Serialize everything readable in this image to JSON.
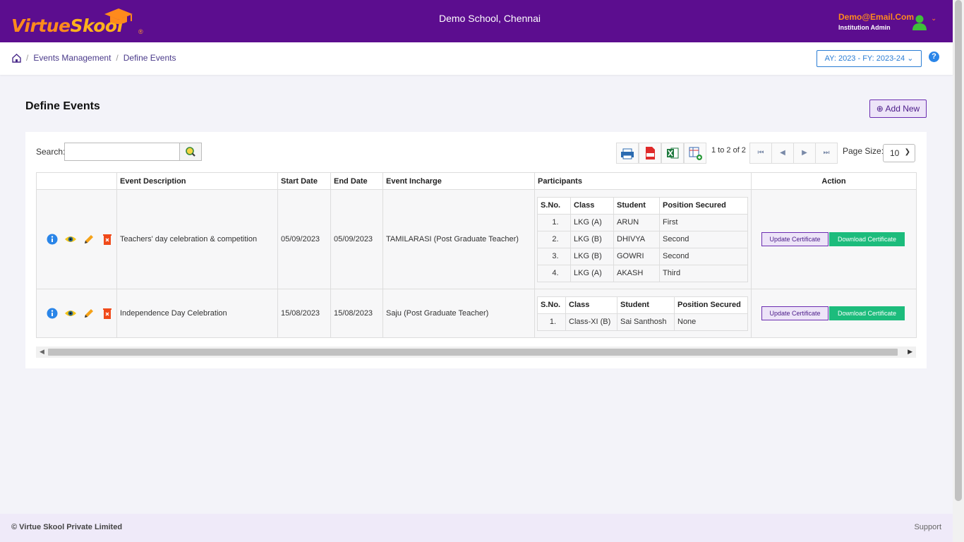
{
  "brand": {
    "part1": "Virtue",
    "part2": "Skool",
    "reg": "®"
  },
  "header": {
    "school": "Demo School, Chennai",
    "email": "Demo@Email.Com",
    "role": "Institution Admin",
    "caret": "⌄"
  },
  "breadcrumb": {
    "items": [
      "Events Management",
      "Define Events"
    ],
    "sep": "/"
  },
  "year_select": "AY: 2023 - FY: 2023-24 ⌄",
  "help": "?",
  "page": {
    "title": "Define Events",
    "add_new": "Add New",
    "add_icon": "⊕"
  },
  "search": {
    "label": "Search:",
    "placeholder": ""
  },
  "pager": {
    "text": "1 to 2 of 2",
    "page_size_label": "Page Size:",
    "page_size": "10"
  },
  "table": {
    "headers": [
      "",
      "Event Description",
      "Start Date",
      "End Date",
      "Event Incharge",
      "Participants",
      "Action"
    ],
    "sub_headers": [
      "S.No.",
      "Class",
      "Student",
      "Position Secured"
    ],
    "update_label": "Update Certificate",
    "download_label": "Download Certificate",
    "rows": [
      {
        "description": "Teachers' day celebration & competition",
        "start": "05/09/2023",
        "end": "05/09/2023",
        "incharge": "TAMILARASI (Post Graduate Teacher)",
        "participants": [
          {
            "sno": "1.",
            "class": "LKG (A)",
            "student": "ARUN",
            "position": "First"
          },
          {
            "sno": "2.",
            "class": "LKG (B)",
            "student": "DHIVYA",
            "position": "Second"
          },
          {
            "sno": "3.",
            "class": "LKG (B)",
            "student": "GOWRI",
            "position": "Second"
          },
          {
            "sno": "4.",
            "class": "LKG (A)",
            "student": "AKASH",
            "position": "Third"
          }
        ]
      },
      {
        "description": "Independence Day Celebration",
        "start": "15/08/2023",
        "end": "15/08/2023",
        "incharge": "Saju (Post Graduate Teacher)",
        "participants": [
          {
            "sno": "1.",
            "class": "Class-XI (B)",
            "student": "Sai Santhosh",
            "position": "None"
          }
        ]
      }
    ]
  },
  "footer": {
    "copyright": "© Virtue Skool Private Limited",
    "support": "Support"
  }
}
